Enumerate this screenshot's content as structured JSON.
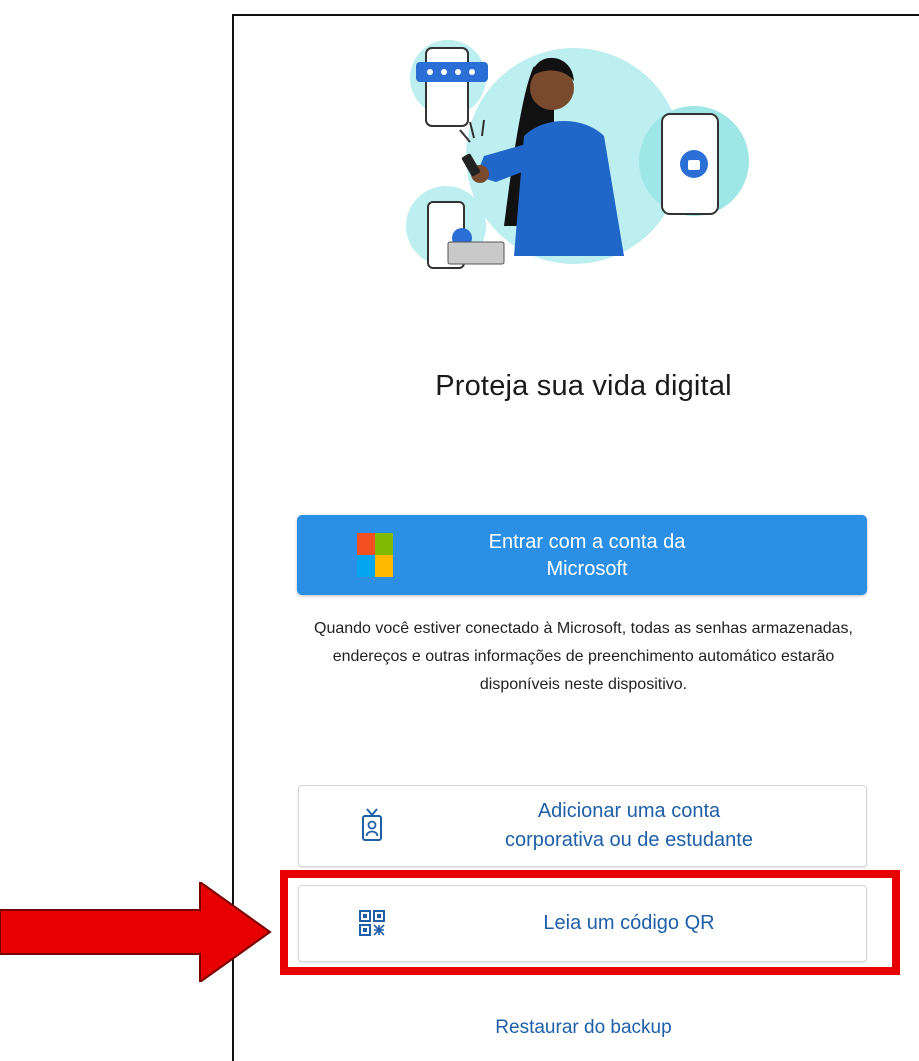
{
  "title": "Proteja sua vida digital",
  "microsoft_button": {
    "label_line1": "Entrar com a conta da",
    "label_line2": "Microsoft",
    "color": "#2b8fe6"
  },
  "description": "Quando você estiver conectado à Microsoft, todas as senhas armazenadas, endereços e outras informações de preenchimento automático estarão disponíveis neste dispositivo.",
  "work_account_button": {
    "label_line1": "Adicionar uma conta",
    "label_line2": "corporativa ou de estudante",
    "icon": "id-badge-icon"
  },
  "qr_button": {
    "label": "Leia um código QR",
    "icon": "qr-code-icon"
  },
  "restore_link": "Restaurar do backup",
  "annotation": {
    "highlight_color": "#e60000",
    "arrow_color": "#e60000"
  },
  "colors": {
    "link": "#1f5fa8",
    "ms_red": "#f25022",
    "ms_green": "#7fba00",
    "ms_blue": "#00a4ef",
    "ms_yellow": "#ffb900"
  }
}
